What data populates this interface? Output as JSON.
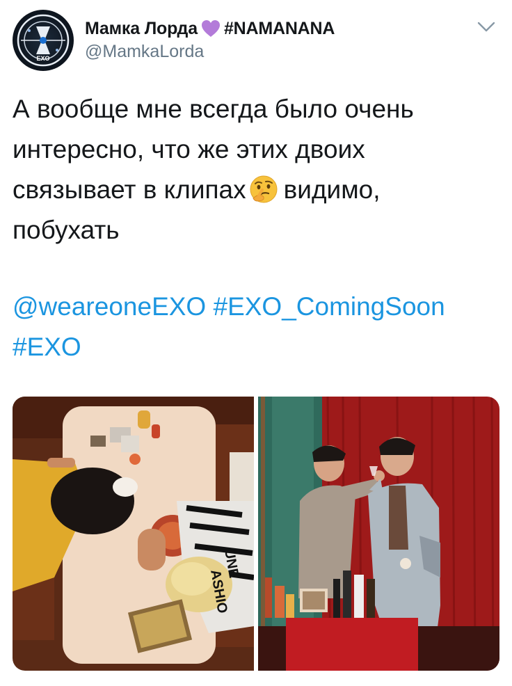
{
  "tweet": {
    "author": {
      "display_name": "Мамка Лорда",
      "hashtag_name": "#NAMANANA",
      "handle": "@MamkaLorda",
      "avatar_text": "EXO"
    },
    "text_lines": [
      "А вообще мне всегда было очень",
      "интересно, что же этих двоих"
    ],
    "text_line3_before": "связывает в клипах",
    "text_line3_after": "видимо,",
    "text_line4": "побухать",
    "mention": "@weareoneEXO",
    "hashtag1": "#EXO_ComingSoon",
    "hashtag2": "#EXO",
    "icons": {
      "heart": "purple-heart-icon",
      "emoji": "thinking-face-icon",
      "menu": "chevron-down-icon"
    },
    "colors": {
      "link": "#1b95e0",
      "handle": "#657786",
      "text": "#14171a",
      "heart": "#b37bd9"
    },
    "media": {
      "left_photo": "overhead-diner-table-photo",
      "right_photo": "red-curtain-bar-photo",
      "left_photo_text": [
        "UNE",
        "ASHIO"
      ]
    }
  }
}
